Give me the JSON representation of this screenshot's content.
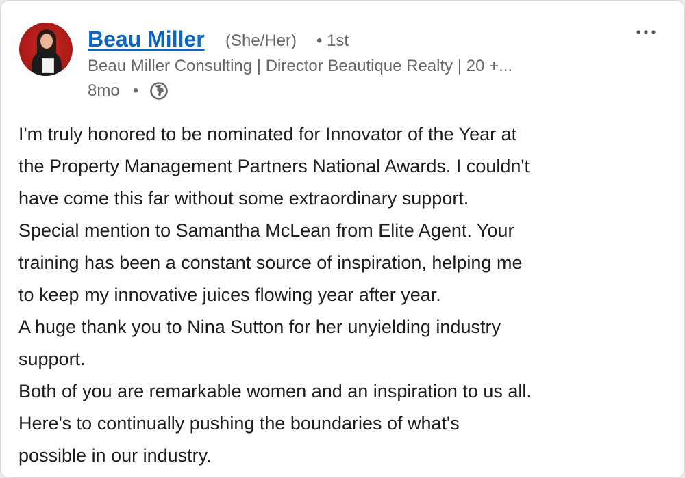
{
  "post": {
    "author": {
      "name": "Beau Miller",
      "pronouns": "(She/Her)",
      "connection": "• 1st",
      "headline": "Beau Miller Consulting | Director Beautique Realty | 20 +...",
      "avatar_icon": "profile-photo"
    },
    "meta": {
      "time": "8mo",
      "separator": "•",
      "visibility_icon": "globe-icon"
    },
    "menu_icon": "more-options-icon",
    "text_lines": [
      "I'm truly honored to be nominated for Innovator of the Year at",
      "the Property Management Partners National Awards. I couldn't",
      "have come this far without some extraordinary support.",
      "Special mention to Samantha McLean from Elite Agent. Your",
      "training has been a constant source of inspiration, helping me",
      "to keep my innovative juices flowing year after year.",
      "A huge thank you to Nina Sutton for her unyielding industry",
      "support.",
      "Both of you are remarkable women and an inspiration to us all.",
      "Here's to continually pushing the boundaries of what's",
      "possible in our industry."
    ]
  },
  "colors": {
    "link": "#0a66c2",
    "secondary_text": "#666666",
    "body_text": "#1c1c1c",
    "avatar_background": "#c8251f"
  }
}
